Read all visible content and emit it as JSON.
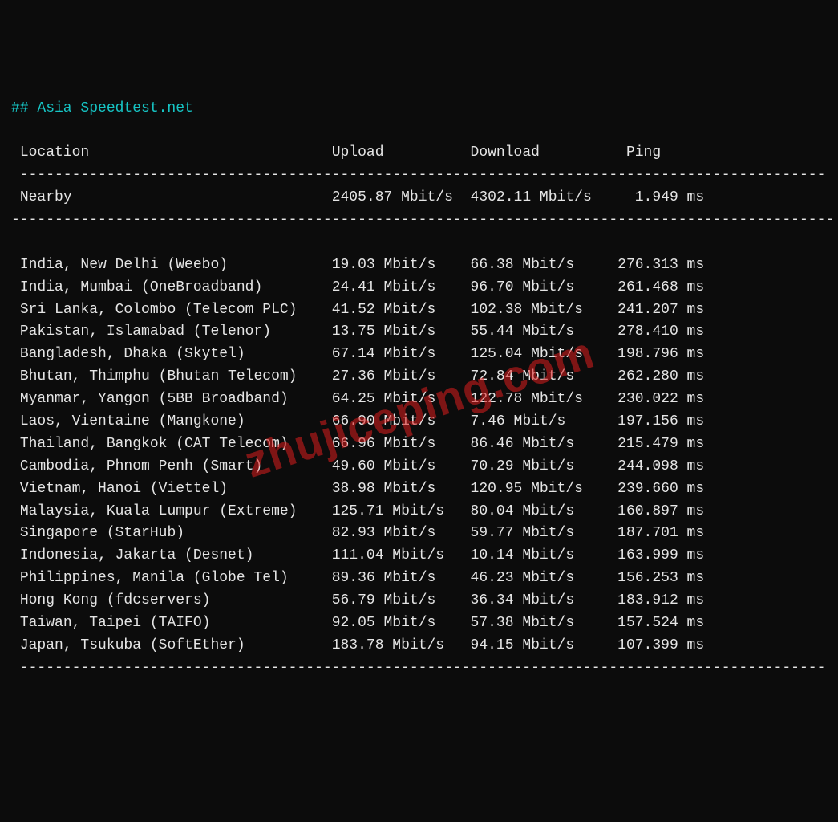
{
  "title": "## Asia Speedtest.net",
  "headers": {
    "location": "Location",
    "upload": "Upload",
    "download": "Download",
    "ping": "Ping"
  },
  "nearby": {
    "label": "Nearby",
    "upload": "2405.87 Mbit/s",
    "download": "4302.11 Mbit/s",
    "ping": "1.949 ms"
  },
  "rows": [
    {
      "location": "India, New Delhi (Weebo)",
      "upload": "19.03 Mbit/s",
      "download": "66.38 Mbit/s",
      "ping": "276.313 ms"
    },
    {
      "location": "India, Mumbai (OneBroadband)",
      "upload": "24.41 Mbit/s",
      "download": "96.70 Mbit/s",
      "ping": "261.468 ms"
    },
    {
      "location": "Sri Lanka, Colombo (Telecom PLC)",
      "upload": "41.52 Mbit/s",
      "download": "102.38 Mbit/s",
      "ping": "241.207 ms"
    },
    {
      "location": "Pakistan, Islamabad (Telenor)",
      "upload": "13.75 Mbit/s",
      "download": "55.44 Mbit/s",
      "ping": "278.410 ms"
    },
    {
      "location": "Bangladesh, Dhaka (Skytel)",
      "upload": "67.14 Mbit/s",
      "download": "125.04 Mbit/s",
      "ping": "198.796 ms"
    },
    {
      "location": "Bhutan, Thimphu (Bhutan Telecom)",
      "upload": "27.36 Mbit/s",
      "download": "72.84 Mbit/s",
      "ping": "262.280 ms"
    },
    {
      "location": "Myanmar, Yangon (5BB Broadband)",
      "upload": "64.25 Mbit/s",
      "download": "122.78 Mbit/s",
      "ping": "230.022 ms"
    },
    {
      "location": "Laos, Vientaine (Mangkone)",
      "upload": "66.90 Mbit/s",
      "download": "7.46 Mbit/s",
      "ping": "197.156 ms"
    },
    {
      "location": "Thailand, Bangkok (CAT Telecom)",
      "upload": "66.96 Mbit/s",
      "download": "86.46 Mbit/s",
      "ping": "215.479 ms"
    },
    {
      "location": "Cambodia, Phnom Penh (Smart)",
      "upload": "49.60 Mbit/s",
      "download": "70.29 Mbit/s",
      "ping": "244.098 ms"
    },
    {
      "location": "Vietnam, Hanoi (Viettel)",
      "upload": "38.98 Mbit/s",
      "download": "120.95 Mbit/s",
      "ping": "239.660 ms"
    },
    {
      "location": "Malaysia, Kuala Lumpur (Extreme)",
      "upload": "125.71 Mbit/s",
      "download": "80.04 Mbit/s",
      "ping": "160.897 ms"
    },
    {
      "location": "Singapore (StarHub)",
      "upload": "82.93 Mbit/s",
      "download": "59.77 Mbit/s",
      "ping": "187.701 ms"
    },
    {
      "location": "Indonesia, Jakarta (Desnet)",
      "upload": "111.04 Mbit/s",
      "download": "10.14 Mbit/s",
      "ping": "163.999 ms"
    },
    {
      "location": "Philippines, Manila (Globe Tel)",
      "upload": "89.36 Mbit/s",
      "download": "46.23 Mbit/s",
      "ping": "156.253 ms"
    },
    {
      "location": "Hong Kong (fdcservers)",
      "upload": "56.79 Mbit/s",
      "download": "36.34 Mbit/s",
      "ping": "183.912 ms"
    },
    {
      "location": "Taiwan, Taipei (TAIFO)",
      "upload": "92.05 Mbit/s",
      "download": "57.38 Mbit/s",
      "ping": "157.524 ms"
    },
    {
      "location": "Japan, Tsukuba (SoftEther)",
      "upload": "183.78 Mbit/s",
      "download": "94.15 Mbit/s",
      "ping": "107.399 ms"
    }
  ],
  "watermark": "zhujiceping.com",
  "chart_data": {
    "type": "table",
    "title": "Asia Speedtest.net",
    "columns": [
      "Location",
      "Upload (Mbit/s)",
      "Download (Mbit/s)",
      "Ping (ms)"
    ],
    "rows": [
      [
        "Nearby",
        2405.87,
        4302.11,
        1.949
      ],
      [
        "India, New Delhi (Weebo)",
        19.03,
        66.38,
        276.313
      ],
      [
        "India, Mumbai (OneBroadband)",
        24.41,
        96.7,
        261.468
      ],
      [
        "Sri Lanka, Colombo (Telecom PLC)",
        41.52,
        102.38,
        241.207
      ],
      [
        "Pakistan, Islamabad (Telenor)",
        13.75,
        55.44,
        278.41
      ],
      [
        "Bangladesh, Dhaka (Skytel)",
        67.14,
        125.04,
        198.796
      ],
      [
        "Bhutan, Thimphu (Bhutan Telecom)",
        27.36,
        72.84,
        262.28
      ],
      [
        "Myanmar, Yangon (5BB Broadband)",
        64.25,
        122.78,
        230.022
      ],
      [
        "Laos, Vientaine (Mangkone)",
        66.9,
        7.46,
        197.156
      ],
      [
        "Thailand, Bangkok (CAT Telecom)",
        66.96,
        86.46,
        215.479
      ],
      [
        "Cambodia, Phnom Penh (Smart)",
        49.6,
        70.29,
        244.098
      ],
      [
        "Vietnam, Hanoi (Viettel)",
        38.98,
        120.95,
        239.66
      ],
      [
        "Malaysia, Kuala Lumpur (Extreme)",
        125.71,
        80.04,
        160.897
      ],
      [
        "Singapore (StarHub)",
        82.93,
        59.77,
        187.701
      ],
      [
        "Indonesia, Jakarta (Desnet)",
        111.04,
        10.14,
        163.999
      ],
      [
        "Philippines, Manila (Globe Tel)",
        89.36,
        46.23,
        156.253
      ],
      [
        "Hong Kong (fdcservers)",
        56.79,
        36.34,
        183.912
      ],
      [
        "Taiwan, Taipei (TAIFO)",
        92.05,
        57.38,
        157.524
      ],
      [
        "Japan, Tsukuba (SoftEther)",
        183.78,
        94.15,
        107.399
      ]
    ]
  }
}
